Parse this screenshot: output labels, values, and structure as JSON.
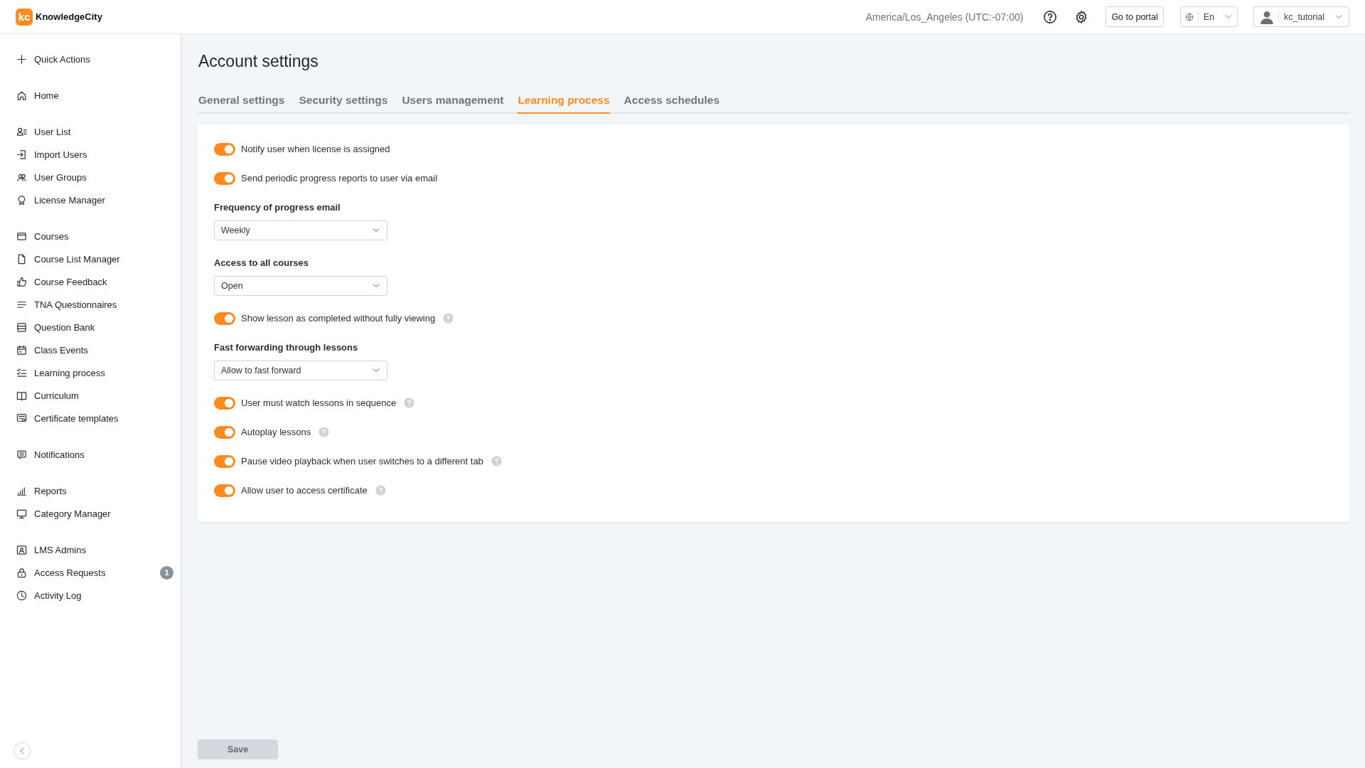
{
  "header": {
    "logo": {
      "mark": "kc",
      "name": "KnowledgeCity"
    },
    "timezone": "America/Los_Angeles (UTC:-07:00)",
    "portal_button": "Go to portal",
    "language": "En",
    "user": "kc_tutorial"
  },
  "sidebar": {
    "groups": [
      {
        "items": [
          {
            "label": "Quick Actions"
          }
        ]
      },
      {
        "items": [
          {
            "label": "Home"
          }
        ]
      },
      {
        "items": [
          {
            "label": "User List"
          },
          {
            "label": "Import Users"
          },
          {
            "label": "User Groups"
          },
          {
            "label": "License Manager"
          }
        ]
      },
      {
        "items": [
          {
            "label": "Courses"
          },
          {
            "label": "Course List Manager"
          },
          {
            "label": "Course Feedback"
          },
          {
            "label": "TNA Questionnaires"
          },
          {
            "label": "Question Bank"
          },
          {
            "label": "Class Events"
          },
          {
            "label": "Learning process"
          },
          {
            "label": "Curriculum"
          },
          {
            "label": "Certificate templates"
          }
        ]
      },
      {
        "items": [
          {
            "label": "Notifications"
          }
        ]
      },
      {
        "items": [
          {
            "label": "Reports"
          },
          {
            "label": "Category Manager"
          }
        ]
      },
      {
        "items": [
          {
            "label": "LMS Admins"
          },
          {
            "label": "Access Requests",
            "badge": "1"
          },
          {
            "label": "Activity Log"
          }
        ]
      }
    ]
  },
  "page": {
    "title": "Account settings",
    "tabs": [
      {
        "label": "General settings",
        "selected": false
      },
      {
        "label": "Security settings",
        "selected": false
      },
      {
        "label": "Users management",
        "selected": false
      },
      {
        "label": "Learning process",
        "selected": true
      },
      {
        "label": "Access schedules",
        "selected": false
      }
    ],
    "settings": [
      {
        "kind": "toggle",
        "label": "Notify user when license is assigned",
        "on": true,
        "help": false
      },
      {
        "kind": "toggle",
        "label": "Send periodic progress reports to user via email",
        "on": true,
        "help": false
      },
      {
        "kind": "select",
        "label": "Frequency of progress email",
        "value": "Weekly"
      },
      {
        "kind": "select",
        "label": "Access to all courses",
        "value": "Open"
      },
      {
        "kind": "toggle",
        "label": "Show lesson as completed without fully viewing",
        "on": true,
        "help": true
      },
      {
        "kind": "select",
        "label": "Fast forwarding through lessons",
        "value": "Allow to fast forward"
      },
      {
        "kind": "toggle",
        "label": "User must watch lessons in sequence",
        "on": true,
        "help": true
      },
      {
        "kind": "toggle",
        "label": "Autoplay lessons",
        "on": true,
        "help": true
      },
      {
        "kind": "toggle",
        "label": "Pause video playback when user switches to a different tab",
        "on": true,
        "help": true
      },
      {
        "kind": "toggle",
        "label": "Allow user to access certificate",
        "on": true,
        "help": true
      }
    ],
    "save_button": {
      "label": "Save",
      "disabled": true
    }
  }
}
